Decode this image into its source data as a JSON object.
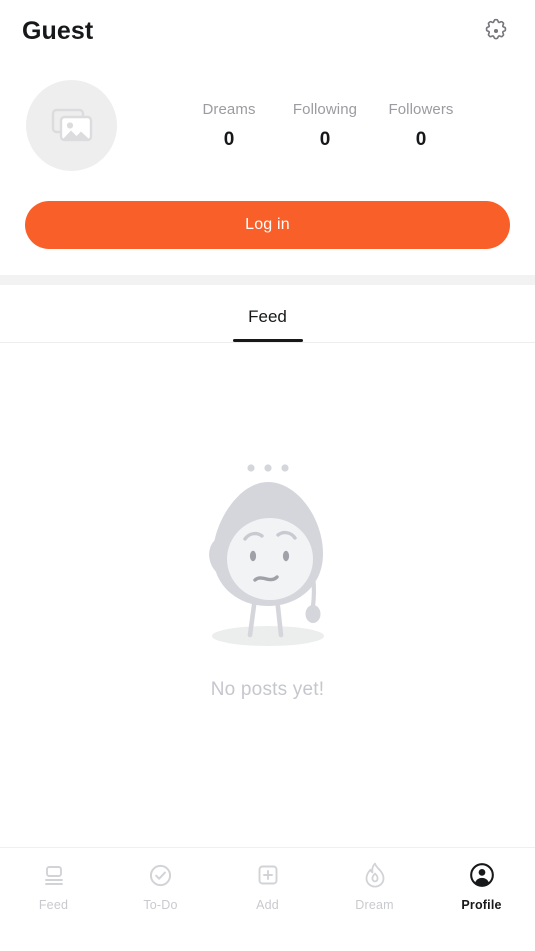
{
  "header": {
    "title": "Guest",
    "settings_icon": "gear-icon"
  },
  "profile": {
    "avatar_icon": "image-placeholder-icon",
    "stats": [
      {
        "label": "Dreams",
        "value": "0"
      },
      {
        "label": "Following",
        "value": "0"
      },
      {
        "label": "Followers",
        "value": "0"
      }
    ],
    "login_label": "Log in"
  },
  "tabs": [
    {
      "label": "Feed",
      "active": true
    }
  ],
  "empty_state": {
    "illustration": "confused-blob-character-icon",
    "message": "No posts yet!"
  },
  "bottom_nav": [
    {
      "label": "Feed",
      "icon": "feed-icon",
      "active": false
    },
    {
      "label": "To-Do",
      "icon": "check-circle-icon",
      "active": false
    },
    {
      "label": "Add",
      "icon": "plus-square-icon",
      "active": false
    },
    {
      "label": "Dream",
      "icon": "flame-icon",
      "active": false
    },
    {
      "label": "Profile",
      "icon": "person-circle-icon",
      "active": true
    }
  ],
  "colors": {
    "accent": "#f95f28",
    "text_primary": "#17181a",
    "text_muted": "#9b9ba1",
    "empty_text": "#c6c7cd",
    "nav_inactive": "#c9cace",
    "divider": "#f2f2f3",
    "avatar_bg": "#eeeeef"
  }
}
